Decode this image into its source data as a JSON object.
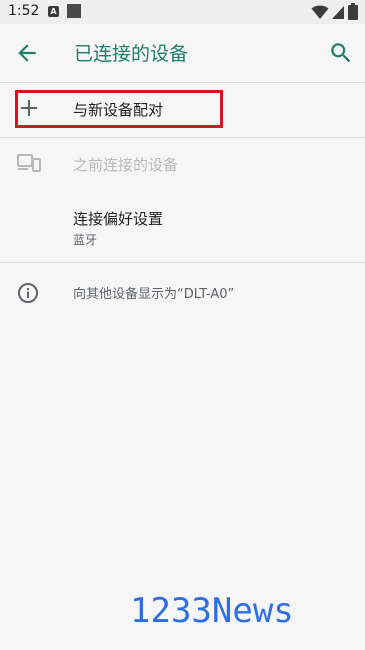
{
  "status_bar": {
    "time": "1:52",
    "icons": [
      "notification-a-icon",
      "notification-square-icon",
      "wifi-icon",
      "signal-icon",
      "battery-icon"
    ]
  },
  "app_bar": {
    "title": "已连接的设备",
    "back_icon": "arrow-back-icon",
    "search_icon": "search-icon",
    "accent_color": "#1f7f69"
  },
  "items": {
    "add": {
      "label": "与新设备配对",
      "icon": "plus-icon",
      "highlight_color": "#d9161d"
    },
    "previous": {
      "label": "之前连接的设备",
      "icon": "devices-icon"
    },
    "preferences": {
      "label": "连接偏好设置",
      "sub": "蓝牙"
    },
    "info": {
      "label": "向其他设备显示为“DLT-A0”",
      "icon": "info-icon"
    }
  },
  "watermark": {
    "text": "1233News",
    "color": "#2f6fe6"
  }
}
